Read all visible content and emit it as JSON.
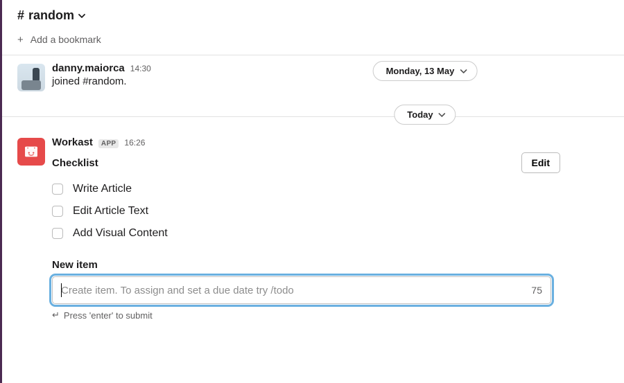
{
  "header": {
    "hash": "#",
    "channel_name": "random"
  },
  "bookmark_bar": {
    "add_label": "Add a bookmark"
  },
  "date_pills": {
    "prev": "Monday, 13 May",
    "today": "Today"
  },
  "messages": {
    "join": {
      "author": "danny.maiorca",
      "time": "14:30",
      "text": "joined #random."
    },
    "workast": {
      "author": "Workast",
      "app_badge": "APP",
      "time": "16:26",
      "title": "Checklist",
      "edit_label": "Edit",
      "items": [
        {
          "label": "Write Article"
        },
        {
          "label": "Edit Article Text"
        },
        {
          "label": "Add Visual Content"
        }
      ],
      "new_item": {
        "label": "New item",
        "placeholder": "Create item. To assign and set a due date try /todo",
        "char_remaining": "75",
        "hint": "Press 'enter' to submit"
      }
    }
  }
}
